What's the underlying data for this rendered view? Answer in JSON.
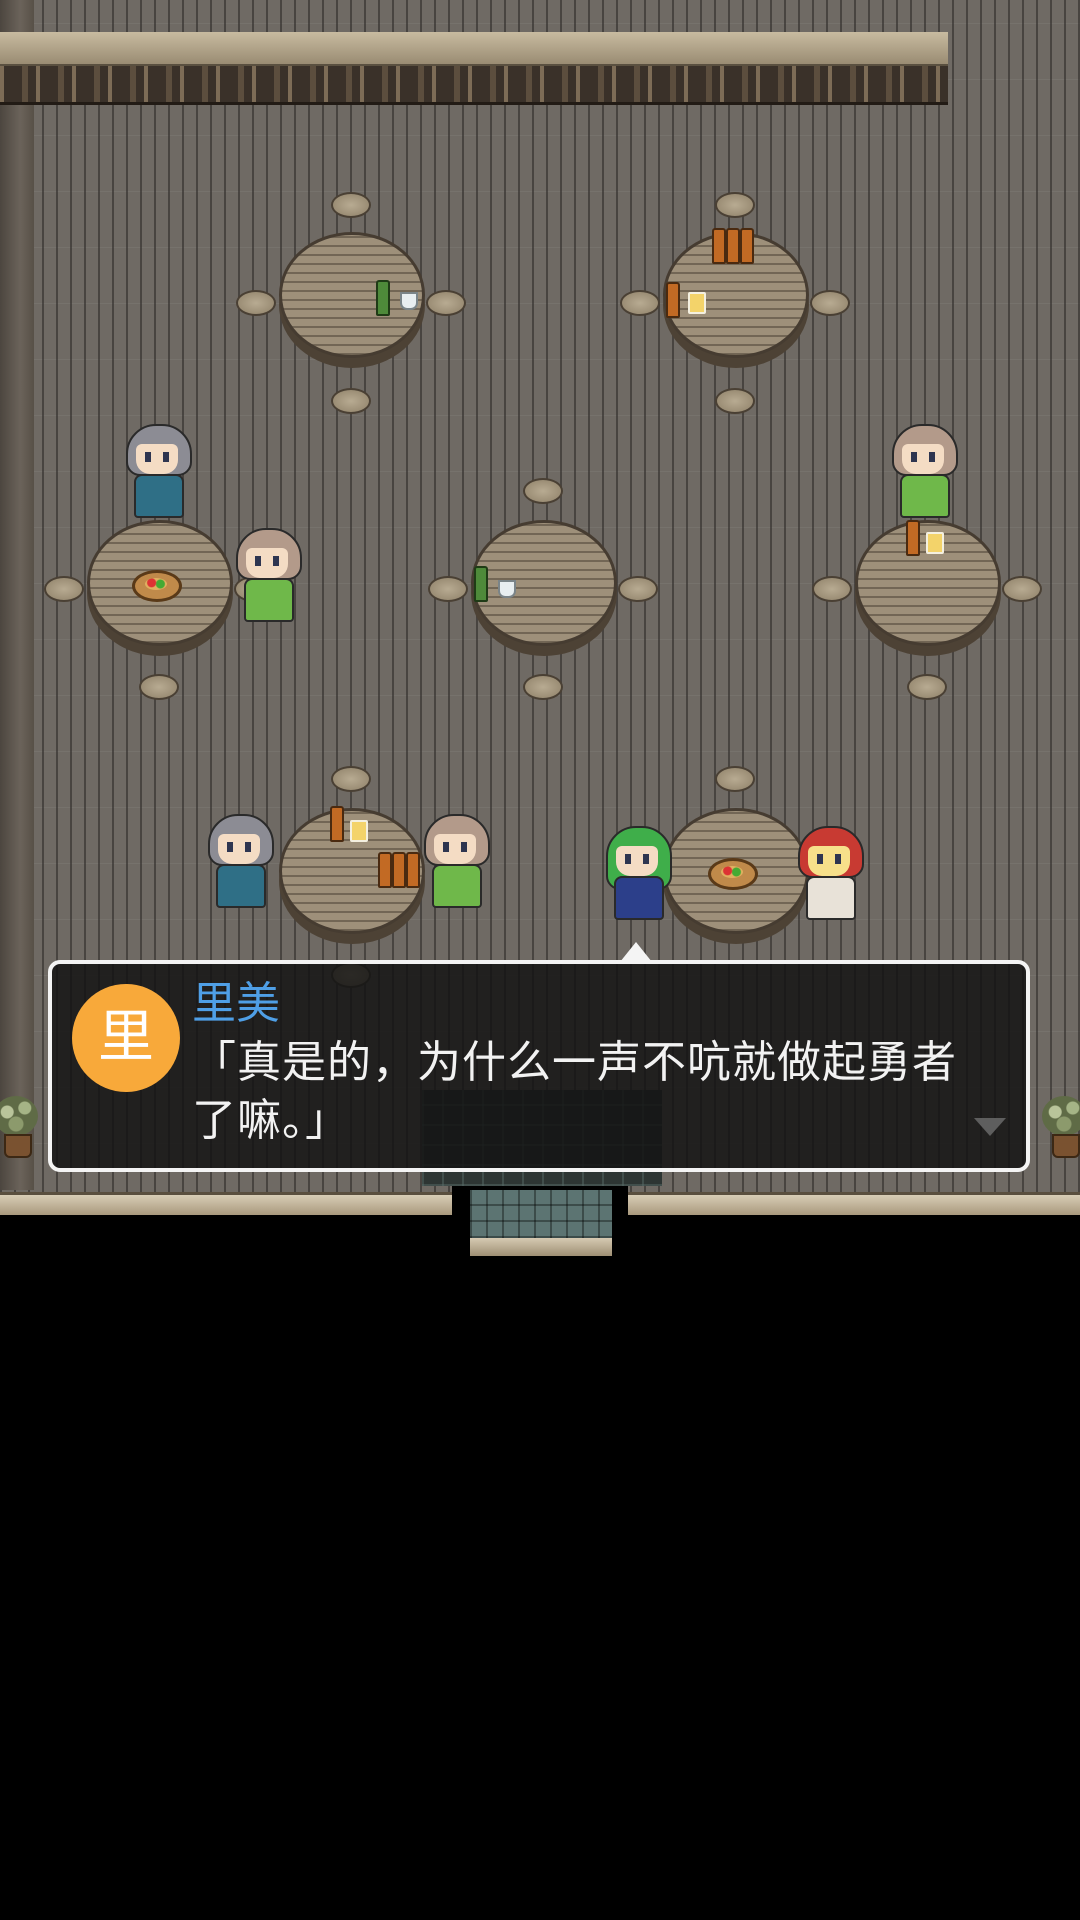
{
  "dialog": {
    "avatar_char": "里",
    "speaker": "里美",
    "message": "「真是的，为什么一声不吭就做起勇者了嘛。」"
  },
  "colors": {
    "avatar_bg": "#f8a93a",
    "speaker_name": "#4f9fe6",
    "dialog_bg": "#141414",
    "dialog_border": "#f4f4f4"
  },
  "scene": {
    "location": "tavern",
    "tables": [
      {
        "items": [
          "green-bottle",
          "wine-glass"
        ]
      },
      {
        "items": [
          "bottles",
          "bottle",
          "beer-mug"
        ]
      },
      {
        "items": [
          "fruit-dish"
        ]
      },
      {
        "items": [
          "green-bottle",
          "wine-glass"
        ]
      },
      {
        "items": [
          "bottle",
          "beer-mug"
        ]
      },
      {
        "items": [
          "bottle",
          "beer-mug",
          "bottles"
        ]
      },
      {
        "items": [
          "fruit-dish"
        ]
      }
    ],
    "characters": [
      "npc-gray-hair",
      "npc-waiter",
      "npc-brown-hair",
      "npc-gray-hair",
      "npc-brown-hair",
      "hero-green-hair",
      "rimi-red-hood"
    ],
    "icons": [
      "next-page-arrow-icon",
      "speech-tail-icon"
    ]
  }
}
